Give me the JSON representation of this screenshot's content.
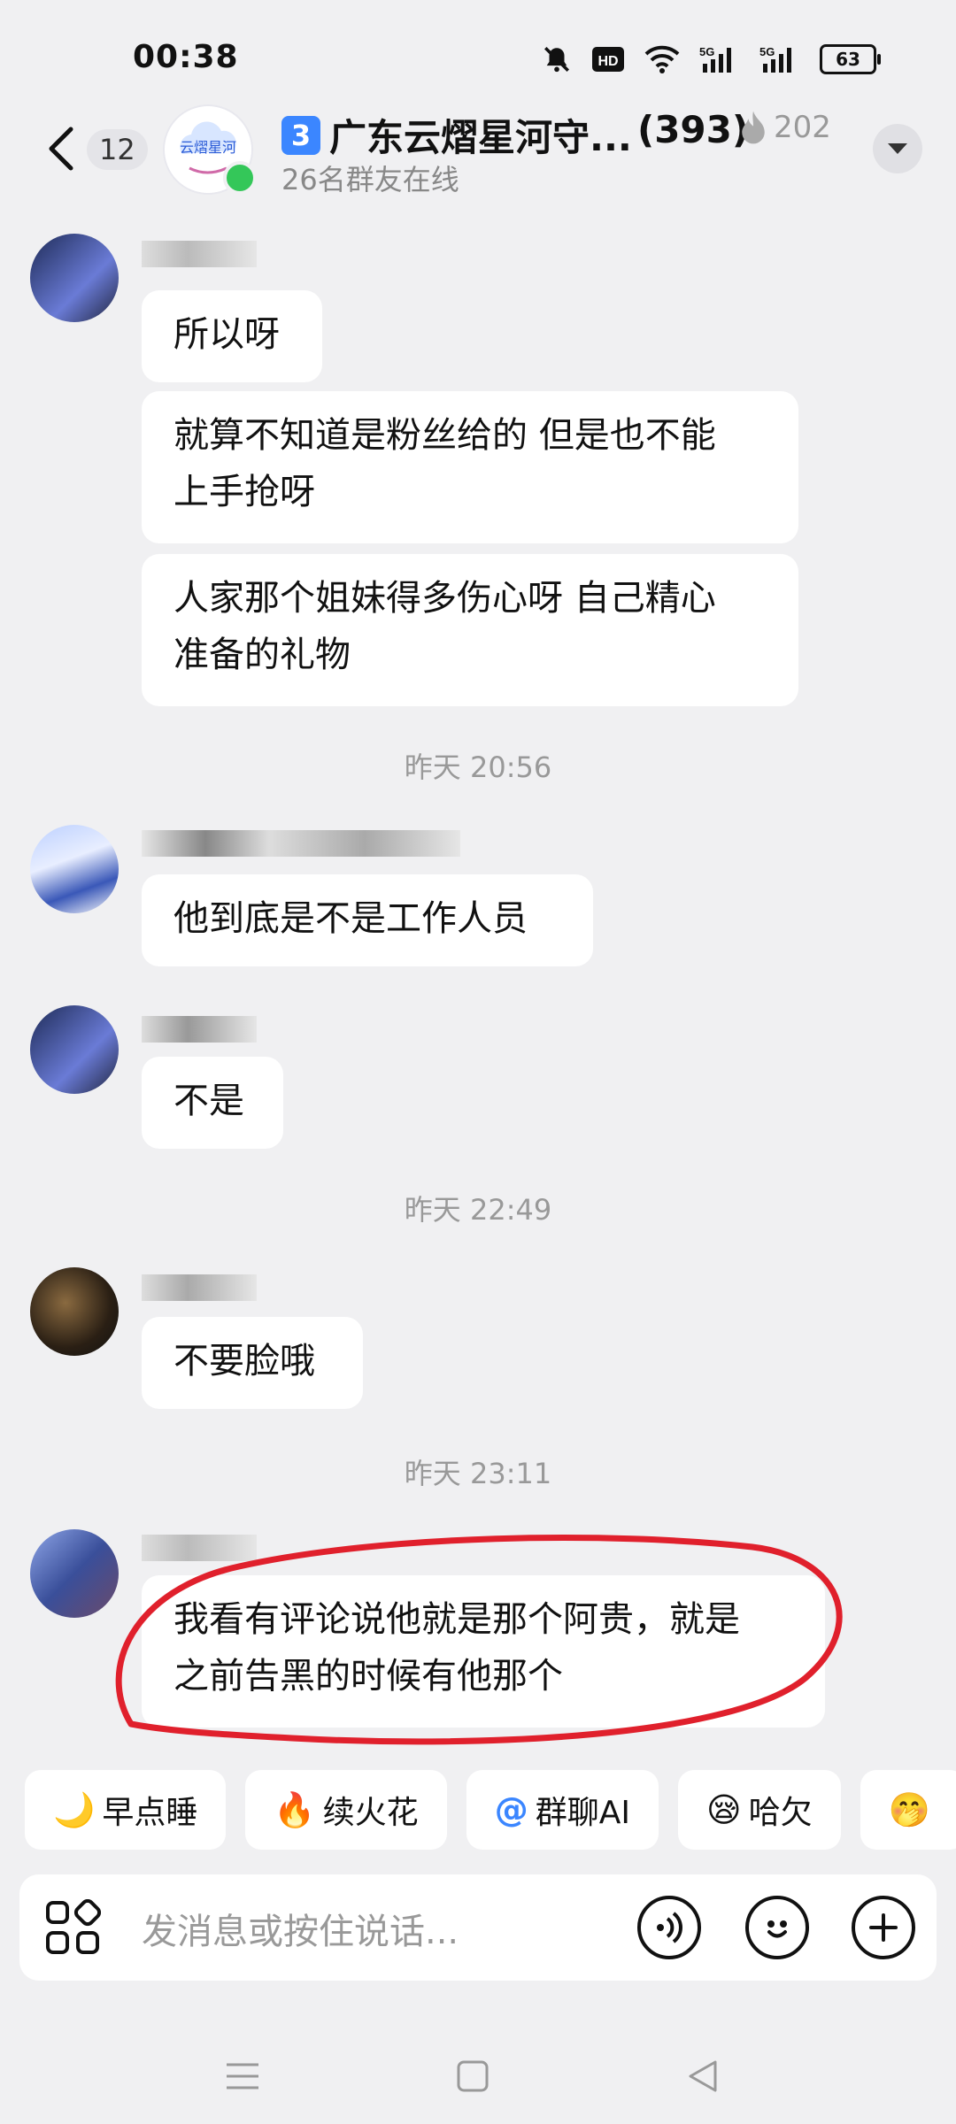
{
  "status": {
    "time": "00:38",
    "battery": "63"
  },
  "header": {
    "back_count": "12",
    "group_title": "广东云熠星河守...",
    "group_count": "(393)",
    "fire_count": "202",
    "online": "26名群友在线",
    "avatar_text": "云熠星河"
  },
  "messages": [
    {
      "bubbles": [
        "所以呀",
        "就算不知道是粉丝给的 但是也不能\n上手抢呀",
        "人家那个姐妹得多伤心呀 自己精心\n准备的礼物"
      ]
    },
    {
      "timestamp": "昨天 20:56",
      "text": "他到底是不是工作人员"
    },
    {
      "text": "不是"
    },
    {
      "timestamp": "昨天 22:49",
      "text": "不要脸哦"
    },
    {
      "timestamp": "昨天 23:11",
      "text": "我看有评论说他就是那个阿贵，就是\n之前告黑的时候有他那个"
    }
  ],
  "quick_replies": [
    {
      "icon": "🌙",
      "label": "早点睡"
    },
    {
      "icon": "🔥",
      "label": "续火花"
    },
    {
      "icon": "@",
      "label": "群聊AI"
    },
    {
      "icon": "😪",
      "label": "哈欠"
    },
    {
      "icon": "🤭",
      "label": ""
    }
  ],
  "input": {
    "placeholder": "发消息或按住说话..."
  },
  "colors": {
    "accent": "#3b86ff",
    "online": "#34c759",
    "annotation": "#e0202c"
  }
}
